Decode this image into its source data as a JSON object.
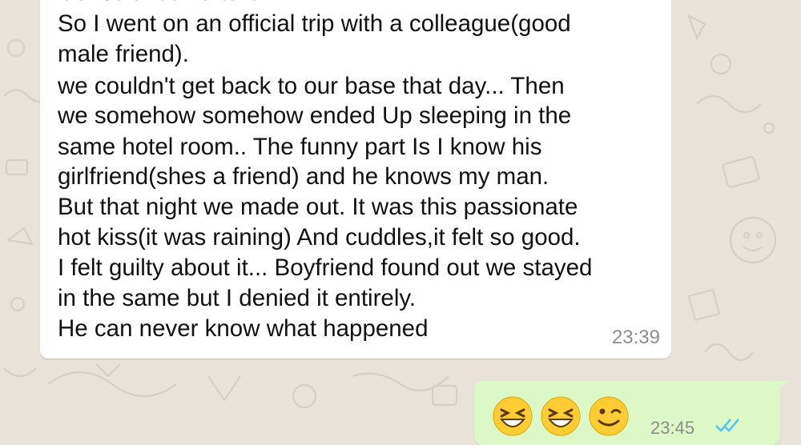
{
  "chat": {
    "incoming": {
      "clipped_top_line": "Conscience Torture",
      "lines": [
        "So I went on an official trip with a colleague(good",
        "male friend).",
        "we couldn't get back to our base that day... Then",
        "we somehow somehow ended Up sleeping in the",
        "same hotel room.. The funny part Is I know his",
        "girlfriend(shes a friend) and he knows my man.",
        "But that night we made out. It was this passionate",
        "hot kiss(it was raining) And cuddles,it felt so good.",
        "I felt guilty about it... Boyfriend found out we stayed",
        "in the same but I denied it entirely.",
        "He can never know what happened"
      ],
      "time": "23:39"
    },
    "outgoing": {
      "emojis": [
        "grinning-squinting-emoji",
        "grinning-squinting-emoji",
        "winking-emoji"
      ],
      "time": "23:45",
      "status_icon": "double-check-icon"
    }
  },
  "colors": {
    "wallpaper": "#e8e2d9",
    "incoming_bubble": "#ffffff",
    "outgoing_bubble": "#dcf8c6",
    "timestamp": "#8c8c8c",
    "read_ticks": "#4fc3f7"
  }
}
